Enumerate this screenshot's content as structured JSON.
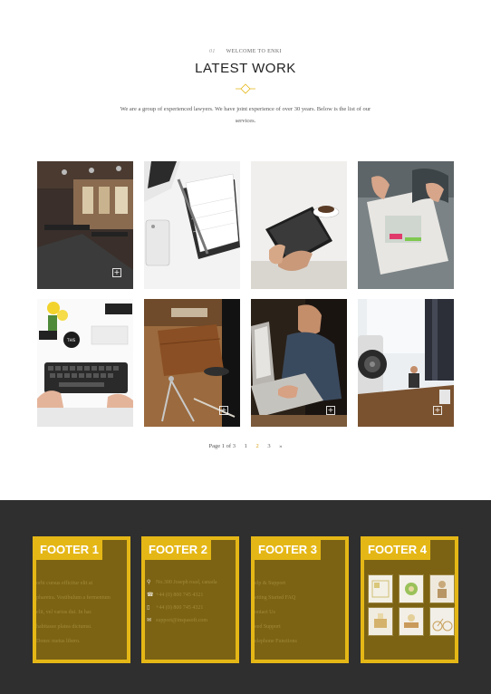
{
  "header": {
    "number": "01",
    "eyebrow": "WELCOME TO ENKI",
    "title": "LATEST WORK",
    "intro": "We are a group of experienced lawyers. We have joint experience of over 30 years. Below is the list of our services."
  },
  "portfolio": {
    "items": [
      {
        "name": "office"
      },
      {
        "name": "notebook-pen"
      },
      {
        "name": "tablet-coffee"
      },
      {
        "name": "desk-papers"
      },
      {
        "name": "keyboard-flowers"
      },
      {
        "name": "leather-compass"
      },
      {
        "name": "laptop-typing"
      },
      {
        "name": "speaker-desk"
      }
    ]
  },
  "pagination": {
    "label": "Page 1 of 3",
    "pages": [
      "1",
      "2",
      "3"
    ],
    "current": "2",
    "next": "»"
  },
  "footer": {
    "col1": {
      "title": "FOOTER 1",
      "lines": [
        "orbi cursus efficitur elit at",
        "pharetra. Vestibulum a fermentum",
        "elit, vel varius dui. In hac",
        "habitasse platea dictumst.",
        "Donec metus libero."
      ]
    },
    "col2": {
      "title": "FOOTER 2",
      "items": [
        {
          "icon": "map-pin-icon",
          "glyph": "⚲",
          "text": "No.300 Joseph road, canada"
        },
        {
          "icon": "phone-icon",
          "glyph": "☎",
          "text": "+44 (0) 800 745 4321"
        },
        {
          "icon": "mobile-icon",
          "glyph": "▯",
          "text": "+44 (0) 800 745 4321"
        },
        {
          "icon": "mail-icon",
          "glyph": "✉",
          "text": "support@inspasoft.com"
        }
      ]
    },
    "col3": {
      "title": "FOOTER 3",
      "links": [
        "elp & Support",
        "etting Started FAQ",
        "ontact Us",
        "eed Support",
        "elephone Functions"
      ]
    },
    "col4": {
      "title": "FOOTER 4"
    }
  },
  "colors": {
    "accent": "#e5b716",
    "footer_bg": "#2f2f2f"
  }
}
